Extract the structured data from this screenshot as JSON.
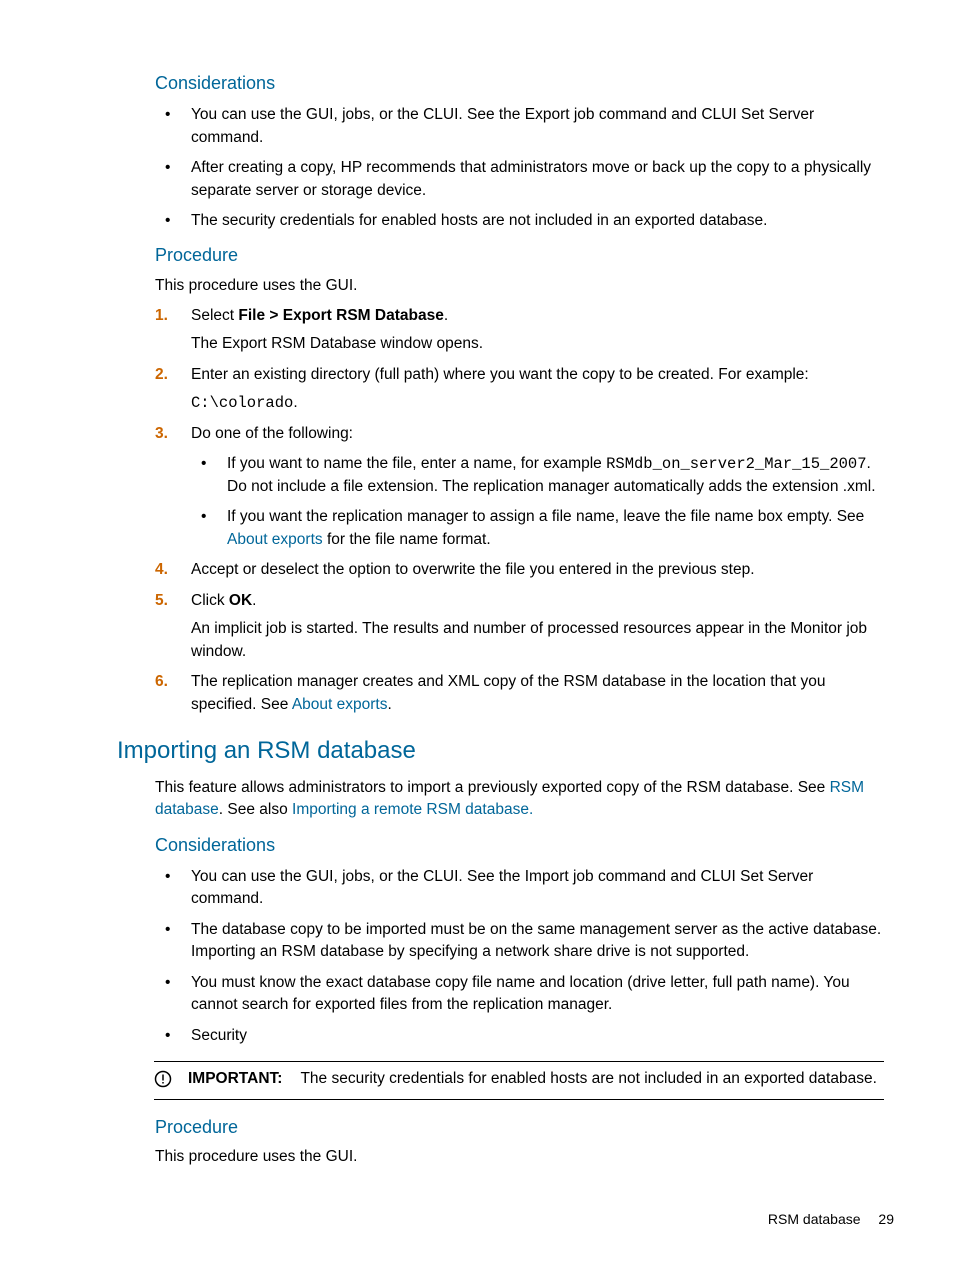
{
  "s1": {
    "considerations_h": "Considerations",
    "b1": "You can use the GUI, jobs, or the CLUI. See the Export job command and CLUI Set Server command.",
    "b2": "After creating a copy, HP recommends that administrators move or back up the copy to a physically separate server or storage device.",
    "b3": "The security credentials for enabled hosts are not included in an exported database.",
    "procedure_h": "Procedure",
    "proc_intro": "This procedure uses the GUI.",
    "step1_a": "Select ",
    "step1_bold": "File > Export RSM Database",
    "step1_c": ".",
    "step1_sub": "The Export RSM Database window opens.",
    "step2_a": "Enter an existing directory (full path) where you want the copy to be created. For example:",
    "step2_code": "C:\\colorado",
    "step2_dot": ".",
    "step3_a": "Do one of the following:",
    "step3_b1_a": "If you want to name the file, enter a name, for example ",
    "step3_b1_code": "RSMdb_on_server2_Mar_15_2007",
    "step3_b1_b": ". Do not include a file extension. The replication manager automatically adds the extension .xml.",
    "step3_b2_a": "If you want the replication manager to assign a file name, leave the file name box empty. See ",
    "step3_b2_link": "About exports",
    "step3_b2_b": " for the file name format.",
    "step4": "Accept or deselect the option to overwrite the file you entered in the previous step.",
    "step5_a": "Click ",
    "step5_bold": "OK",
    "step5_b": ".",
    "step5_sub": "An implicit job is started. The results and number of processed resources appear in the Monitor job window.",
    "step6_a": "The replication manager creates and XML copy of the RSM database in the location that you specified. See ",
    "step6_link": "About exports",
    "step6_b": "."
  },
  "s2": {
    "title": "Importing an RSM database",
    "intro_a": "This feature allows administrators to import a previously exported copy of the RSM database. See ",
    "link1": "RSM database",
    "intro_b": ". See also ",
    "link2": "Importing a remote RSM database.",
    "considerations_h": "Considerations",
    "b1": "You can use the GUI, jobs, or the CLUI. See the Import job command and CLUI Set Server command.",
    "b2": "The database copy to be imported must be on the same management server as the active database. Importing an RSM database by specifying a network share drive is not supported.",
    "b3": "You must know the exact database copy file name and location (drive letter, full path name). You cannot search for exported files from the replication manager.",
    "b4": "Security",
    "important_label": "IMPORTANT:",
    "important_text": "The security credentials for enabled hosts are not included in an exported database.",
    "procedure_h": "Procedure",
    "proc_intro": "This procedure uses the GUI."
  },
  "footer": {
    "title": "RSM database",
    "page": "29"
  }
}
